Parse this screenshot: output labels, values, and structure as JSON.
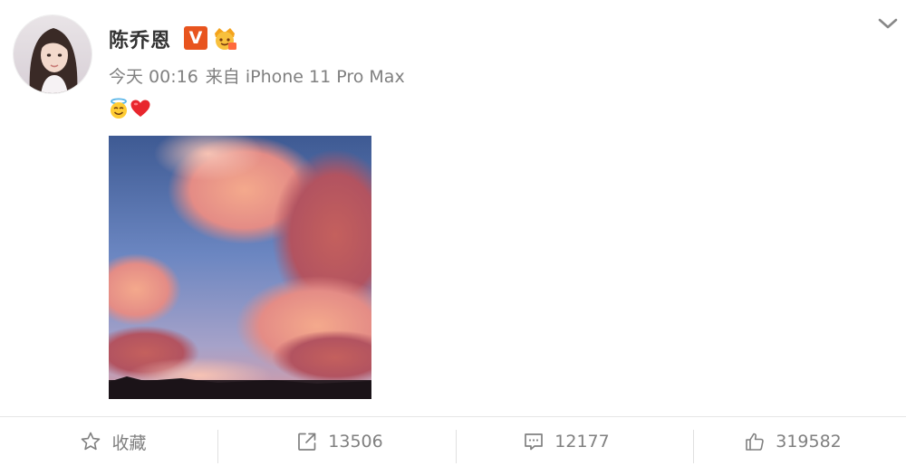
{
  "post": {
    "author": {
      "name": "陈乔恩",
      "verified_badge": "V",
      "verified_color": "#e8541e",
      "avatar_icon": "avatar-photo",
      "fan_badge_icon": "fan-crown-icon"
    },
    "time": "今天 00:16",
    "source": "来自 iPhone 11 Pro Max",
    "content_emojis": [
      "smiling-face-with-halo",
      "red-heart"
    ],
    "image": "sunset-clouds-photo"
  },
  "actions": [
    {
      "label": "收藏",
      "icon": "star-icon"
    },
    {
      "label": "13506",
      "icon": "repost-icon"
    },
    {
      "label": "12177",
      "icon": "comment-icon"
    },
    {
      "label": "319582",
      "icon": "thumbs-up-icon"
    }
  ],
  "colors": {
    "text_primary": "#333333",
    "text_secondary": "#808080",
    "divider": "#e6e6e6"
  }
}
